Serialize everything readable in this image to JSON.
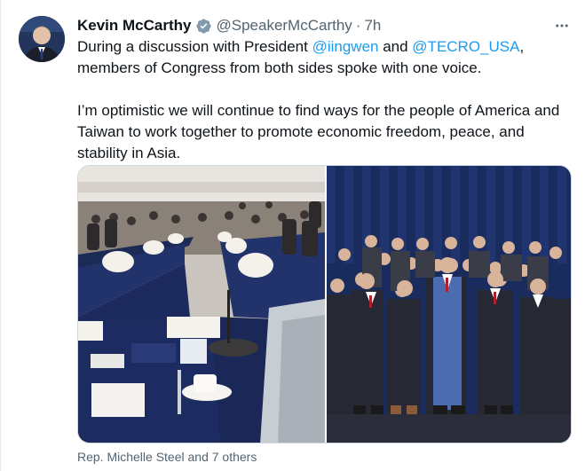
{
  "author": {
    "name": "Kevin McCarthy",
    "handle": "@SpeakerMcCarthy",
    "separator": "·",
    "time": "7h",
    "verified": true,
    "avatar_icon": "profile-photo-icon"
  },
  "tweet": {
    "line1_prefix": "During a discussion with President ",
    "mention1": "@iingwen",
    "line1_middle": " and ",
    "mention2": "@TECRO_USA",
    "line1_suffix": ",",
    "line2": "members of Congress from both sides spoke with one voice.",
    "paragraph2": "I’m optimistic we will continue to find ways for the people of America and Taiwan to work together to promote economic freedom, peace, and stability in Asia."
  },
  "media": {
    "photos": [
      {
        "name": "conference-table-photo"
      },
      {
        "name": "group-photo"
      }
    ]
  },
  "tagged": {
    "text": "Rep. Michelle Steel and 7 others"
  },
  "colors": {
    "link": "#1d9bf0",
    "secondary_text": "#536471",
    "verified_badge": "#1d9bf0"
  }
}
